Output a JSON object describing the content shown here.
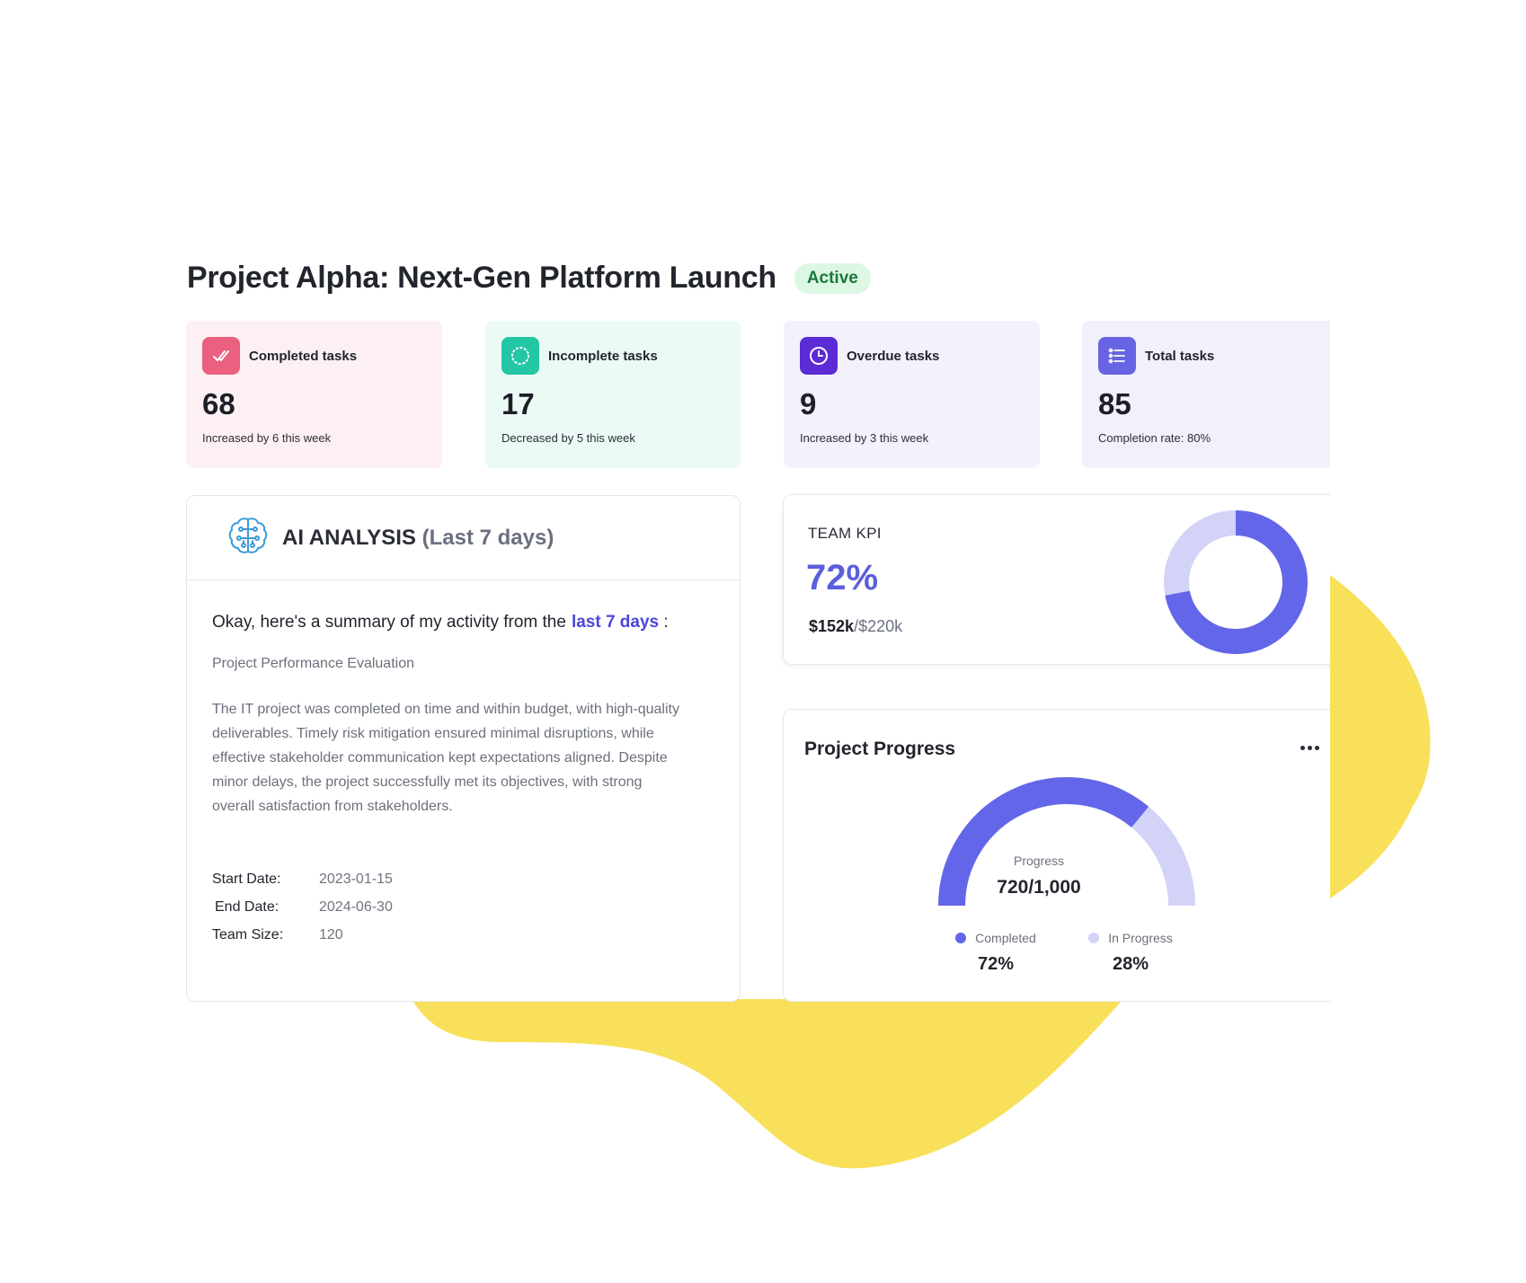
{
  "colors": {
    "accent": "#6366e8",
    "accent_light": "#d2d3f7",
    "blob": "#f9e05a",
    "active_badge_bg": "#dcf7e3",
    "active_badge_text": "#1b7a3a"
  },
  "header": {
    "title": "Project Alpha: Next-Gen Platform Launch",
    "status": "Active"
  },
  "stats": [
    {
      "label": "Completed tasks",
      "value": "68",
      "note": "Increased by 6 this week",
      "icon": "double-check-icon",
      "icon_color": "#e9617f"
    },
    {
      "label": "Incomplete tasks",
      "value": "17",
      "note": "Decreased by 5 this week",
      "icon": "dotted-circle-icon",
      "icon_color": "#24c7a4"
    },
    {
      "label": "Overdue tasks",
      "value": "9",
      "note": "Increased by 3 this week",
      "icon": "clock-icon",
      "icon_color": "#5b2bd6"
    },
    {
      "label": "Total tasks",
      "value": "85",
      "note": "Completion rate: 80%",
      "icon": "list-icon",
      "icon_color": "#6764e3"
    }
  ],
  "ai_analysis": {
    "title": "AI ANALYSIS",
    "title_suffix": "(Last 7 days)",
    "icon": "brain-icon",
    "intro_text": "Okay, here's a summary of my activity from the",
    "intro_highlight": "last 7 days",
    "intro_end": ":",
    "section_title": "Project Performance Evaluation",
    "summary": "The IT project was completed on time and within budget, with high-quality deliverables. Timely risk mitigation ensured minimal disruptions, while effective stakeholder communication kept expectations aligned. Despite minor delays, the project successfully met its objectives, with strong overall satisfaction from stakeholders.",
    "meta": [
      {
        "label": "Start Date:",
        "value": "2023-01-15"
      },
      {
        "label": "End Date:",
        "value": "2024-06-30"
      },
      {
        "label": "Team Size:",
        "value": "120"
      }
    ]
  },
  "team_kpi": {
    "label": "TEAM KPI",
    "value": "72%",
    "amount_current": "$152k",
    "amount_total": "/$220k",
    "fraction": 0.72
  },
  "project_progress": {
    "title": "Project Progress",
    "more_icon": "more-horizontal-icon",
    "gauge_label": "Progress",
    "gauge_value": "720/1,000",
    "fraction": 0.72,
    "legend": [
      {
        "label": "Completed",
        "value": "72%"
      },
      {
        "label": "In Progress",
        "value": "28%"
      }
    ]
  }
}
